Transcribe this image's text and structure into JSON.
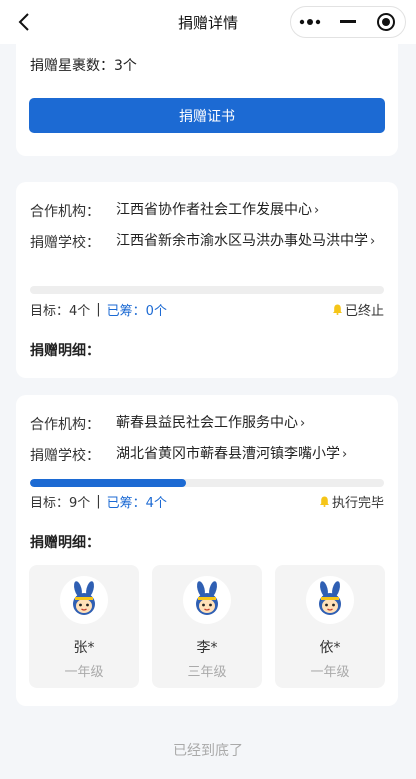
{
  "nav": {
    "title": "捐赠详情",
    "back_icon": "chevron-left-icon",
    "more_icon": "more-dots-icon",
    "minimize_icon": "minimize-icon",
    "close_icon": "record-icon"
  },
  "card1": {
    "stars_label": "捐赠星裹数：",
    "stars_value": "3个",
    "cert_button": "捐赠证书"
  },
  "card2": {
    "partner_label": "合作机构：",
    "partner_value": "江西省协作者社会工作发展中心",
    "school_label": "捐赠学校：",
    "school_value": "江西省新余市渝水区马洪办事处马洪中学",
    "progress": 0,
    "goal_text": "目标：4个",
    "divider": "|",
    "raised_text": "已筹：0个",
    "status": "已终止",
    "detail_title": "捐赠明细："
  },
  "card3": {
    "partner_label": "合作机构：",
    "partner_value": "蕲春县益民社会工作服务中心",
    "school_label": "捐赠学校：",
    "school_value": "湖北省黄冈市蕲春县漕河镇李嘴小学",
    "progress": 0.44,
    "goal_text": "目标：9个",
    "divider": "|",
    "raised_text": "已筹：4个",
    "status": "执行完毕",
    "detail_title": "捐赠明细：",
    "donors": [
      {
        "name": "张*",
        "grade": "一年级"
      },
      {
        "name": "李*",
        "grade": "三年级"
      },
      {
        "name": "依*",
        "grade": "一年级"
      }
    ]
  },
  "colors": {
    "accent": "#1c6ad3",
    "status_bell": "#f5c518"
  },
  "footer": "已经到底了"
}
